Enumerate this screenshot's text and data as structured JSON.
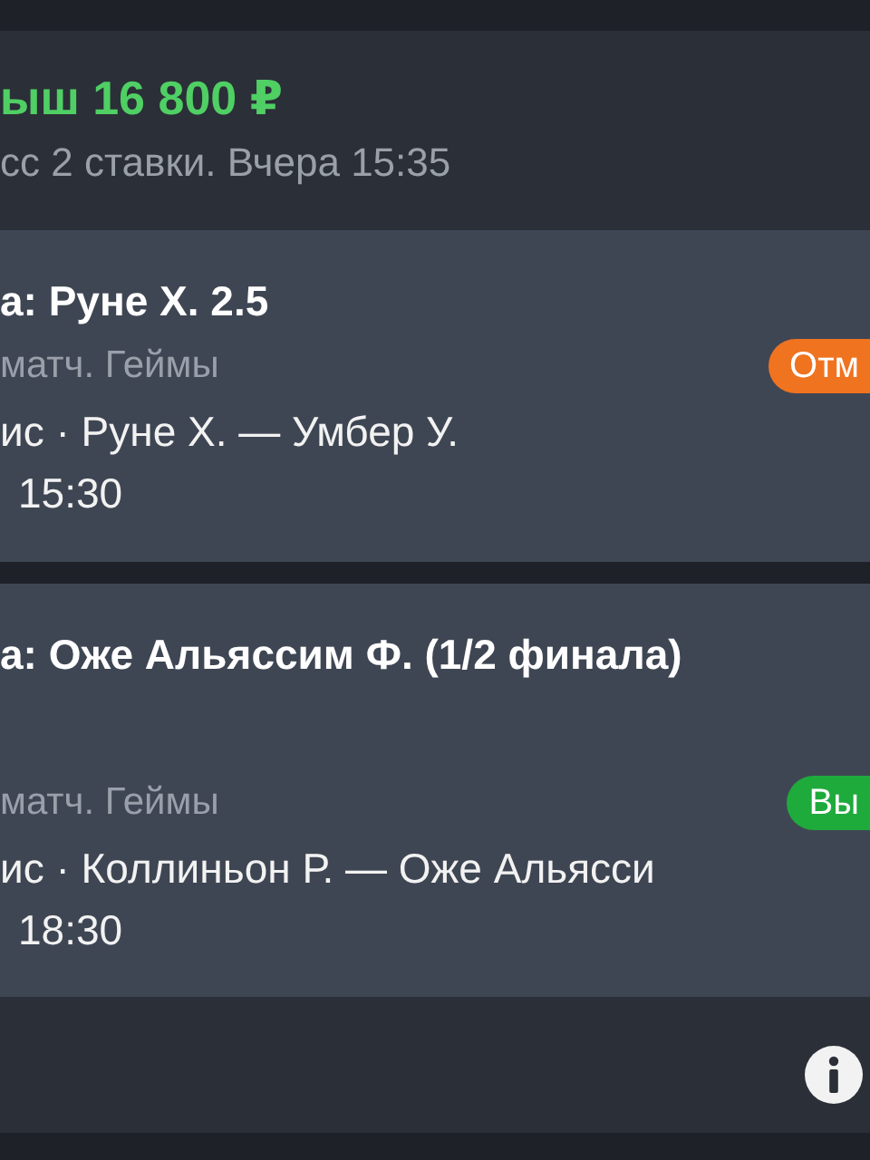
{
  "summary": {
    "amount": "ыш 16 800 ₽",
    "details": "сс 2 ставки. Вчера 15:35"
  },
  "bets": [
    {
      "title": "а: Руне Х. 2.5",
      "market": "матч. Геймы",
      "color": "#f0731f",
      "badge": "Отм",
      "match": "ис · Руне Х. — Умбер У.",
      "time": "15:30"
    },
    {
      "title": "а: Оже Альяссим Ф. (1/2 финала)",
      "market": "матч. Геймы",
      "color": "#1faa3c",
      "badge": "Вы",
      "match": "ис · Коллиньон Р. — Оже Альясси",
      "time": "18:30"
    }
  ]
}
